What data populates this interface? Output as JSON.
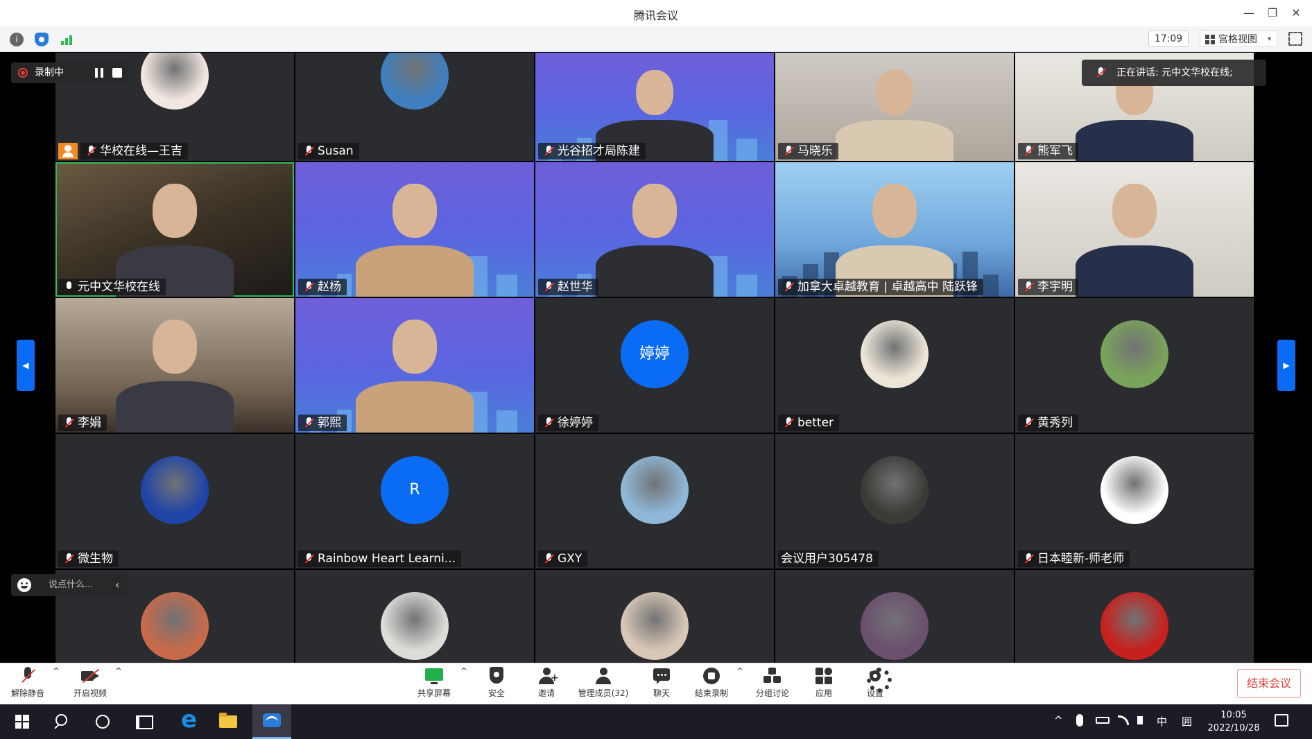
{
  "window": {
    "title": "腾讯会议",
    "minimize": "—",
    "restore": "❐",
    "close": "✕"
  },
  "statusbar": {
    "info_icon": "i",
    "timer": "17:09",
    "view_label": "宫格视图",
    "view_caret": "▾"
  },
  "recording": {
    "label": "录制中"
  },
  "speaking": {
    "label": "正在讲话: 元中文华校在线;"
  },
  "chat_input": {
    "placeholder": "说点什么...",
    "collapse": "‹"
  },
  "pager": {
    "prev": "◀",
    "next": "▶"
  },
  "participants": [
    {
      "name": "华校在线—王吉",
      "kind": "avatar",
      "avatar_color": "#f1e7e0",
      "host": true
    },
    {
      "name": "Susan",
      "kind": "avatar",
      "avatar_color": "#3f7fbf"
    },
    {
      "name": "光谷招才局陈建",
      "kind": "video",
      "bg": "purple"
    },
    {
      "name": "马晓乐",
      "kind": "video",
      "bg": "grey"
    },
    {
      "name": "熊军飞",
      "kind": "video",
      "bg": "office"
    },
    {
      "name": "元中文华校在线",
      "kind": "video",
      "bg": "room",
      "speaking": true
    },
    {
      "name": "赵杨",
      "kind": "video",
      "bg": "purple"
    },
    {
      "name": "赵世华",
      "kind": "video",
      "bg": "purple"
    },
    {
      "name": "加拿大卓越教育 | 卓越高中 陆跃锋",
      "kind": "video",
      "bg": "city"
    },
    {
      "name": "李宇明",
      "kind": "video",
      "bg": "office"
    },
    {
      "name": "李娟",
      "kind": "video",
      "bg": "restaurant"
    },
    {
      "name": "郭熙",
      "kind": "video",
      "bg": "purple"
    },
    {
      "name": "徐婷婷",
      "kind": "avatar",
      "avatar_text": "婷婷"
    },
    {
      "name": "better",
      "kind": "avatar",
      "avatar_color": "#ece6d8"
    },
    {
      "name": "黄秀列",
      "kind": "avatar",
      "avatar_color": "#7aa35a"
    },
    {
      "name": "微生物",
      "kind": "avatar",
      "avatar_color": "#1e44a8"
    },
    {
      "name": "Rainbow Heart Learni...",
      "kind": "avatar",
      "avatar_text": "R"
    },
    {
      "name": "GXY",
      "kind": "avatar",
      "avatar_color": "#8fb8d8"
    },
    {
      "name": "会议用户305478",
      "kind": "avatar",
      "avatar_color": "#3c3a36",
      "plain": true
    },
    {
      "name": "日本睦新-师老师",
      "kind": "avatar",
      "avatar_color": "#ffffff"
    },
    {
      "name": "",
      "kind": "avatar",
      "avatar_color": "#c76a4a"
    },
    {
      "name": "",
      "kind": "avatar",
      "avatar_color": "#dcdcd8"
    },
    {
      "name": "",
      "kind": "avatar",
      "avatar_color": "#d8c7b6"
    },
    {
      "name": "",
      "kind": "avatar",
      "avatar_color": "#6b4f6e"
    },
    {
      "name": "",
      "kind": "avatar",
      "avatar_color": "#c8201c"
    }
  ],
  "toolbar": {
    "unmute": "解除静音",
    "start_video": "开启视频",
    "share_screen": "共享屏幕",
    "security": "安全",
    "invite": "邀请",
    "manage_members": "管理成员(32)",
    "chat": "聊天",
    "end_recording": "结束录制",
    "breakout": "分组讨论",
    "apps": "应用",
    "settings": "设置",
    "end_meeting": "结束会议",
    "caret": "^"
  },
  "taskbar": {
    "tray_up": "^",
    "ime": "中",
    "ime2": "囲",
    "time": "10:05",
    "date": "2022/10/28"
  },
  "colors": {
    "accent": "#0a6cf5",
    "end_red": "#e23b33",
    "share_green": "#21b04b"
  }
}
